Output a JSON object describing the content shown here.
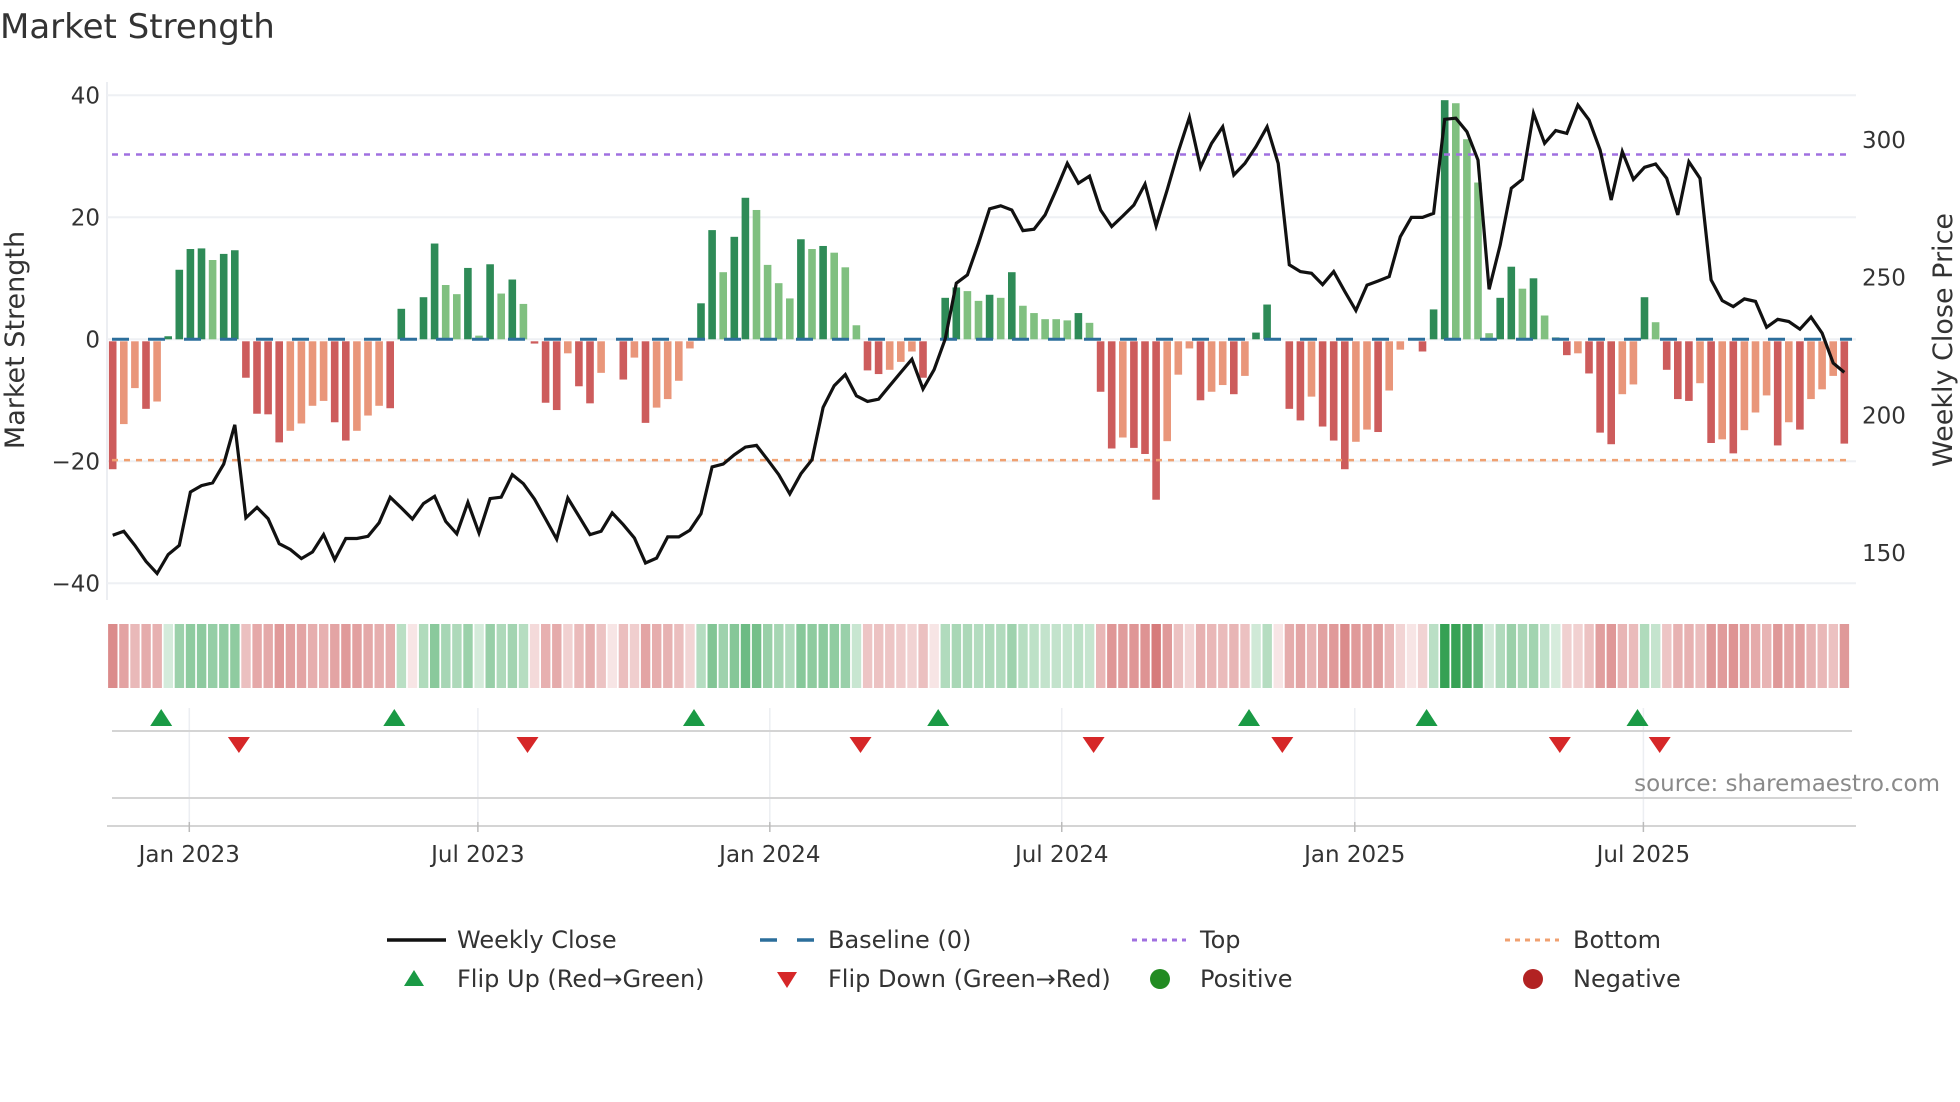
{
  "chart_data": {
    "type": "bar",
    "title": "Market Strength",
    "ylabel": "Market Strength",
    "y2label": "Weekly Close Price",
    "ylim": [
      -42,
      42
    ],
    "y2lim": [
      145,
      318
    ],
    "yticks": [
      {
        "v": 40,
        "label": "40"
      },
      {
        "v": 20,
        "label": "20"
      },
      {
        "v": 0,
        "label": "0"
      },
      {
        "v": -20,
        "label": "−20"
      },
      {
        "v": -40,
        "label": "−40"
      }
    ],
    "y2ticks": [
      {
        "v": 300,
        "label": "300"
      },
      {
        "v": 250,
        "label": "250"
      },
      {
        "v": 200,
        "label": "200"
      },
      {
        "v": 150,
        "label": "150"
      }
    ],
    "xticks": [
      {
        "week": 7.9,
        "label": "Jan 2023"
      },
      {
        "week": 33.9,
        "label": "Jul 2023"
      },
      {
        "week": 60.2,
        "label": "Jan 2024"
      },
      {
        "week": 86.5,
        "label": "Jul 2024"
      },
      {
        "week": 112.9,
        "label": "Jan 2025"
      },
      {
        "week": 138.9,
        "label": "Jul 2025"
      }
    ],
    "top_level": 30.3,
    "bottom_level": -19.8,
    "baseline": 0,
    "strength": [
      -21.3,
      -13.9,
      -8.0,
      -11.4,
      -10.2,
      0.5,
      11.4,
      14.8,
      14.9,
      13.0,
      14.0,
      14.6,
      -6.3,
      -12.2,
      -12.3,
      -16.9,
      -15.0,
      -13.8,
      -10.9,
      -10.1,
      -13.6,
      -16.6,
      -15.0,
      -12.5,
      -10.9,
      -11.3,
      5.0,
      0,
      6.9,
      15.7,
      8.9,
      7.4,
      11.7,
      0.6,
      12.3,
      7.5,
      9.8,
      5.8,
      -0.7,
      -10.4,
      -11.6,
      -2.3,
      -7.7,
      -10.5,
      -5.5,
      0,
      -6.6,
      -3.0,
      -13.7,
      -11.2,
      -9.8,
      -6.8,
      -1.5,
      5.9,
      17.9,
      11.0,
      16.8,
      23.2,
      21.2,
      12.2,
      9.2,
      6.7,
      16.4,
      14.8,
      15.3,
      14.2,
      11.8,
      2.3,
      -5.1,
      -5.7,
      -5.0,
      -3.7,
      -2.0,
      -6.3,
      0,
      6.8,
      8.5,
      7.9,
      6.3,
      7.3,
      6.8,
      11.0,
      5.5,
      4.3,
      3.3,
      3.3,
      3.1,
      4.3,
      2.7,
      -8.6,
      -17.9,
      -16.1,
      -17.8,
      -18.8,
      -26.3,
      -16.7,
      -5.8,
      -1.5,
      -10.0,
      -8.6,
      -7.5,
      -9.0,
      -6.0,
      1.1,
      5.7,
      0,
      -11.4,
      -13.3,
      -9.4,
      -14.3,
      -16.6,
      -21.3,
      -16.8,
      -14.8,
      -15.2,
      -8.4,
      -1.7,
      0,
      -2.0,
      4.9,
      39.2,
      38.7,
      32.8,
      25.7,
      1.0,
      6.8,
      11.9,
      8.3,
      10.0,
      3.9,
      0.3,
      -2.6,
      -2.3,
      -5.6,
      -15.3,
      -17.2,
      -9.0,
      -7.4,
      6.9,
      2.8,
      -5.0,
      -9.8,
      -10.1,
      -7.2,
      -17.0,
      -16.4,
      -18.7,
      -14.9,
      -12.0,
      -9.2,
      -17.4,
      -13.6,
      -14.8,
      -9.8,
      -8.2,
      -6.0,
      -17.1
    ],
    "strength_rising": [
      1,
      0,
      0,
      1,
      0,
      1,
      1,
      1,
      1,
      0,
      1,
      1,
      1,
      1,
      1,
      1,
      0,
      0,
      0,
      0,
      1,
      1,
      0,
      0,
      0,
      1,
      1,
      0,
      1,
      1,
      0,
      0,
      1,
      0,
      1,
      0,
      1,
      0,
      1,
      1,
      1,
      0,
      1,
      1,
      0,
      0,
      1,
      0,
      1,
      0,
      0,
      0,
      0,
      1,
      1,
      0,
      1,
      1,
      0,
      0,
      0,
      0,
      1,
      0,
      1,
      0,
      0,
      0,
      1,
      1,
      0,
      0,
      0,
      1,
      0,
      1,
      1,
      0,
      0,
      1,
      0,
      1,
      0,
      0,
      0,
      0,
      0,
      1,
      0,
      1,
      1,
      0,
      1,
      1,
      1,
      0,
      0,
      0,
      1,
      0,
      0,
      1,
      0,
      1,
      1,
      0,
      1,
      1,
      0,
      1,
      1,
      1,
      0,
      0,
      1,
      0,
      0,
      0,
      1,
      1,
      1,
      0,
      0,
      0,
      0,
      1,
      1,
      0,
      1,
      0,
      1,
      1,
      0,
      1,
      1,
      1,
      0,
      0,
      1,
      0,
      1,
      1,
      1,
      0,
      1,
      0,
      1,
      0,
      0,
      0,
      1,
      0,
      1,
      0,
      0,
      0,
      1
    ],
    "weekly_close": [
      156.5,
      157.9,
      152.8,
      147.0,
      142.6,
      149.5,
      152.8,
      172.2,
      174.5,
      175.5,
      182.3,
      196.6,
      162.8,
      166.6,
      162.5,
      153.4,
      151.3,
      148.0,
      150.4,
      156.7,
      147.6,
      155.3,
      155.3,
      156.1,
      161.0,
      170.3,
      166.4,
      162.4,
      168.0,
      170.6,
      161.5,
      157.0,
      168.4,
      157.3,
      169.8,
      170.3,
      178.5,
      175.2,
      169.6,
      162.4,
      155.1,
      170.0,
      163.4,
      156.7,
      157.9,
      164.6,
      160.3,
      155.5,
      146.4,
      148.2,
      155.9,
      155.9,
      158.3,
      164.3,
      181.3,
      182.3,
      185.7,
      188.5,
      189.1,
      183.9,
      178.5,
      171.5,
      178.8,
      183.9,
      202.9,
      210.8,
      214.8,
      207.1,
      205.1,
      205.9,
      210.8,
      215.6,
      220.4,
      209.6,
      216.6,
      227.7,
      248.0,
      251.0,
      262.5,
      275.0,
      276.1,
      274.6,
      267.1,
      267.6,
      272.8,
      281.9,
      291.5,
      284.3,
      286.9,
      274.6,
      268.6,
      272.4,
      276.4,
      284.0,
      268.8,
      281.9,
      295.8,
      308.2,
      290.1,
      298.8,
      304.8,
      287.3,
      291.5,
      297.6,
      304.8,
      291.5,
      254.7,
      252.2,
      251.6,
      247.5,
      252.2,
      245.0,
      238.1,
      247.3,
      248.8,
      250.4,
      264.9,
      271.9,
      271.9,
      273.4,
      307.5,
      307.9,
      303.0,
      292.7,
      245.8,
      261.9,
      282.5,
      285.7,
      309.7,
      298.8,
      303.4,
      302.4,
      312.7,
      307.3,
      296.4,
      278.2,
      295.8,
      285.7,
      290.1,
      291.3,
      286.1,
      272.8,
      292.1,
      286.1,
      249.2,
      241.7,
      239.5,
      242.3,
      241.4,
      232.0,
      234.9,
      234.1,
      231.3,
      235.7,
      229.9,
      219.0,
      215.6
    ],
    "flip_up_weeks": [
      6,
      27,
      54,
      76,
      104,
      120,
      139
    ],
    "flip_down_weeks": [
      13,
      39,
      69,
      90,
      107,
      132,
      141
    ],
    "legend": {
      "placement": "bottom",
      "items": [
        {
          "key": "weekly_close",
          "label": "Weekly Close"
        },
        {
          "key": "baseline",
          "label": "Baseline (0)"
        },
        {
          "key": "top",
          "label": "Top"
        },
        {
          "key": "bottom",
          "label": "Bottom"
        },
        {
          "key": "flip_up",
          "label": "Flip Up (Red→Green)"
        },
        {
          "key": "flip_down",
          "label": "Flip Down (Green→Red)"
        },
        {
          "key": "positive",
          "label": "Positive"
        },
        {
          "key": "negative",
          "label": "Negative"
        }
      ]
    },
    "annotation": "source: sharemaestro.com"
  },
  "colors": {
    "pos_strong": "#2e8b57",
    "pos_weak": "#80c080",
    "neg_strong": "#cd5c5c",
    "neg_weak": "#e9967a",
    "price_line": "#111111",
    "baseline": "#2c6e9b",
    "top": "#a070e0",
    "bottom": "#f0a070",
    "flip_up": "#1a9a45",
    "flip_down": "#d62728",
    "positive_dot": "#228b22",
    "negative_dot": "#b22222"
  }
}
